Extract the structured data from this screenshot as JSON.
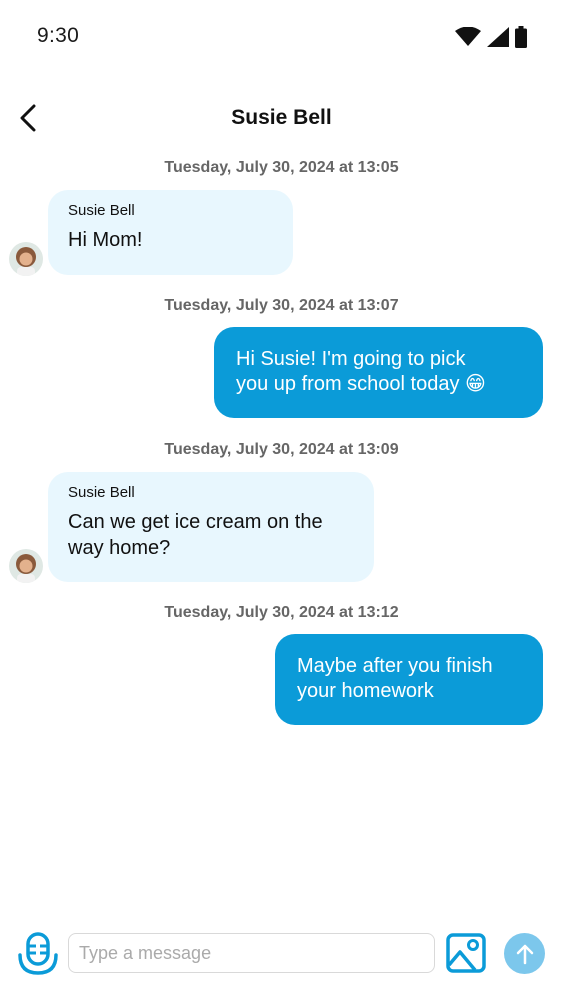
{
  "status_bar": {
    "time": "9:30",
    "icons": [
      "wifi-icon",
      "cellular-signal-icon",
      "battery-icon"
    ]
  },
  "header": {
    "back_icon": "chevron-left-icon",
    "title": "Susie Bell"
  },
  "messages": [
    {
      "timestamp": "Tuesday, July 30, 2024 at 13:05",
      "direction": "incoming",
      "sender": "Susie Bell",
      "text": "Hi Mom!"
    },
    {
      "timestamp": "Tuesday, July 30, 2024 at 13:07",
      "direction": "outgoing",
      "line1": "Hi Susie! I'm going to pick",
      "line2": "you up from school today 😁"
    },
    {
      "timestamp": "Tuesday, July 30, 2024 at 13:09",
      "direction": "incoming",
      "sender": "Susie Bell",
      "line1": "Can we get ice cream on the",
      "line2": "way home?"
    },
    {
      "timestamp": "Tuesday, July 30, 2024 at 13:12",
      "direction": "outgoing",
      "line1": "Maybe after you finish",
      "line2": "your homework"
    }
  ],
  "composer": {
    "mic_icon": "microphone-icon",
    "input_placeholder": "Type a message",
    "input_value": "",
    "image_icon": "image-icon",
    "send_icon": "arrow-up-icon"
  },
  "colors": {
    "incoming_bubble": "#e8f7fe",
    "outgoing_bubble": "#0b9bd8",
    "accent": "#0b9bd8",
    "send_button": "#7cc7ec"
  }
}
